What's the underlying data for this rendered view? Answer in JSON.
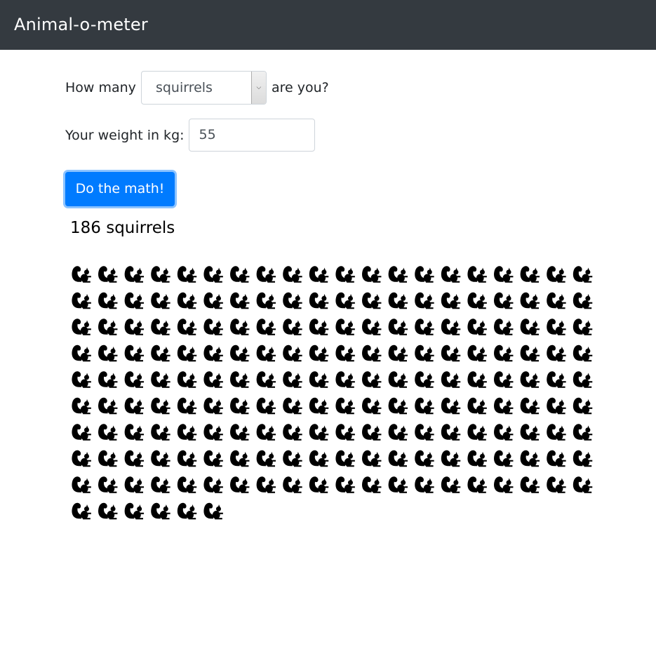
{
  "navbar": {
    "brand": "Animal-o-meter"
  },
  "form": {
    "how_many_label": "How many",
    "animal_select": {
      "selected": "squirrels"
    },
    "are_you_label": "are you?",
    "weight_label": "Your weight in kg:",
    "weight_value": "55"
  },
  "actions": {
    "submit_label": "Do the math!"
  },
  "result": {
    "text": "186 squirrels",
    "count": 186,
    "icon": "squirrel-icon",
    "icon_color": "#000000"
  },
  "colors": {
    "navbar_bg": "#343a40",
    "primary_button": "#007bff"
  }
}
